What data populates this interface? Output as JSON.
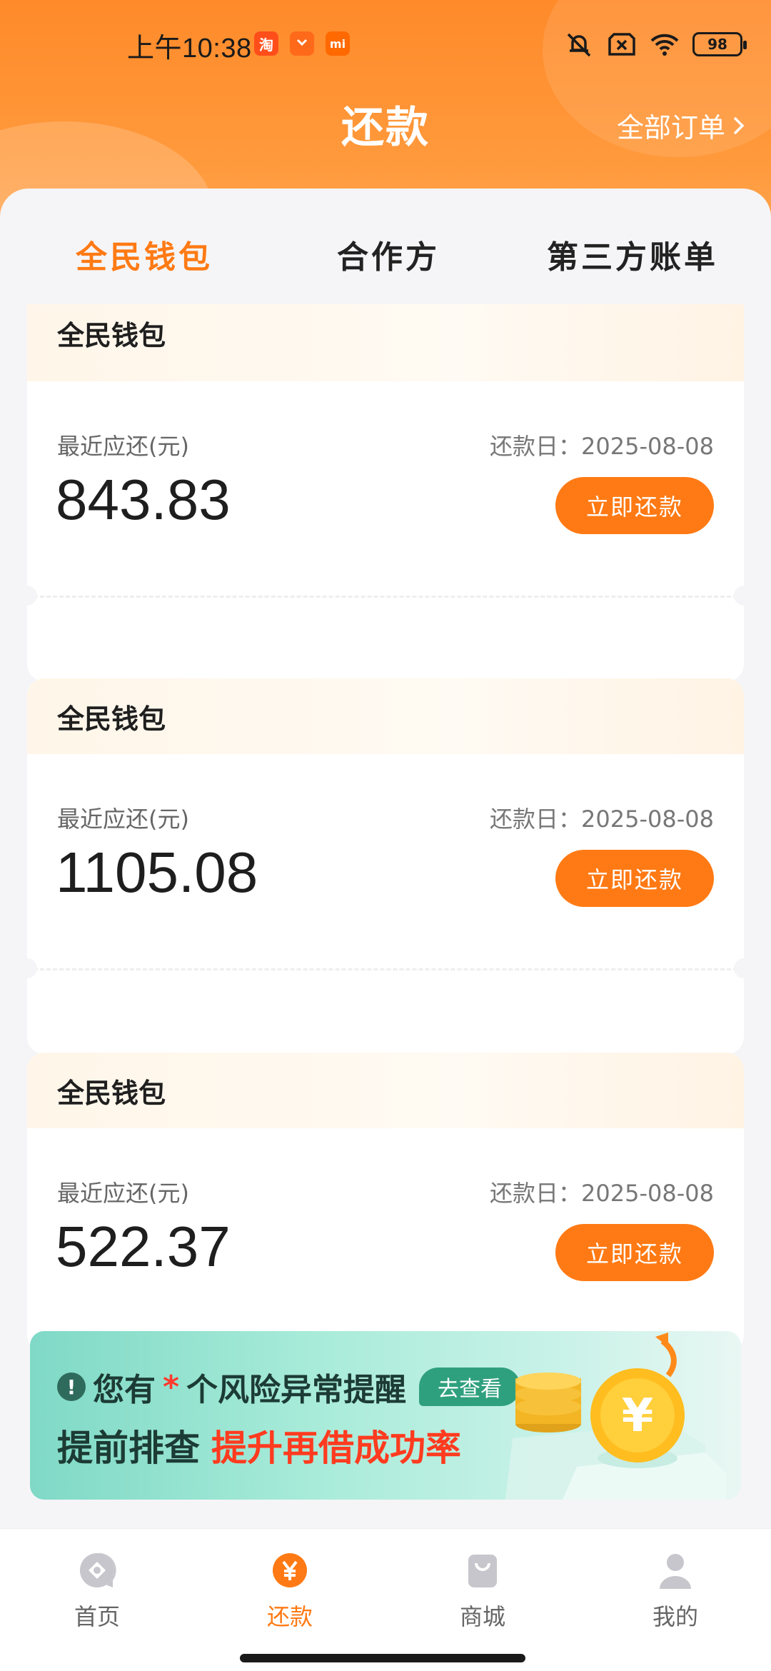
{
  "status_bar": {
    "time": "上午10:38",
    "app_icons": [
      "taobao-icon",
      "xiaomi-store-icon",
      "mi-icon"
    ],
    "taobao_glyph": "淘",
    "mi_glyph": "mi",
    "battery": "98"
  },
  "header": {
    "title": "还款",
    "all_orders": "全部订单",
    "chevron": "›"
  },
  "tabs": [
    {
      "label": "全民钱包",
      "active": true
    },
    {
      "label": "合作方",
      "active": false
    },
    {
      "label": "第三方账单",
      "active": false
    }
  ],
  "cards": [
    {
      "name": "全民钱包",
      "due_label": "最近应还(元)",
      "amount": "843.83",
      "due_date": "还款日：2025-08-08",
      "button": "立即还款"
    },
    {
      "name": "全民钱包",
      "due_label": "最近应还(元)",
      "amount": "1105.08",
      "due_date": "还款日：2025-08-08",
      "button": "立即还款"
    },
    {
      "name": "全民钱包",
      "due_label": "最近应还(元)",
      "amount": "522.37",
      "due_date": "还款日：2025-08-08",
      "button": "立即还款"
    }
  ],
  "banner": {
    "line1_prefix": "您有",
    "line1_star": "*",
    "line1_suffix": "个风险异常提醒",
    "tag": "去查看",
    "line2_a": "提前排查",
    "line2_b": "提升再借成功率",
    "coin_symbol": "¥"
  },
  "bottom_nav": [
    {
      "label": "首页",
      "icon": "home-icon",
      "active": false
    },
    {
      "label": "还款",
      "icon": "yuan-icon",
      "active": true
    },
    {
      "label": "商城",
      "icon": "shopping-bag-icon",
      "active": false
    },
    {
      "label": "我的",
      "icon": "profile-icon",
      "active": false
    }
  ],
  "colors": {
    "accent": "#ff7a14",
    "header_top": "#ff8a2a",
    "banner_green": "#2fa07e",
    "alert_red": "#ff3b1f"
  }
}
